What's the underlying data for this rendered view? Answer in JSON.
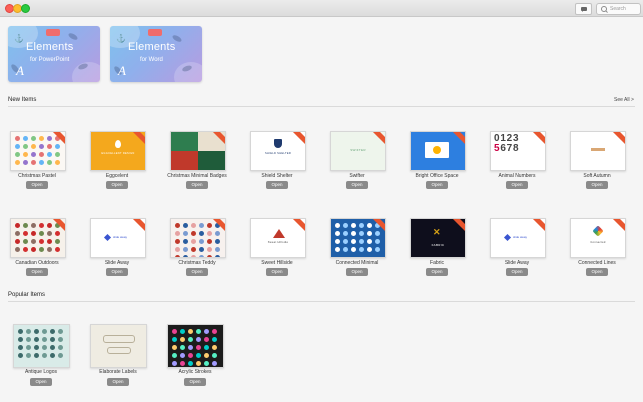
{
  "window": {
    "search_placeholder": "Search"
  },
  "banners": [
    {
      "title": "Elements",
      "subtitle": "for PowerPoint",
      "letter": "A"
    },
    {
      "title": "Elements",
      "subtitle": "for Word",
      "letter": "A"
    }
  ],
  "new_items": {
    "heading": "New Items",
    "see_all": "See All >",
    "open_label": "Open",
    "row1": [
      {
        "name": "Christmas Pastel",
        "thumb": "pastel"
      },
      {
        "name": "Eggcelent",
        "thumb": "egg",
        "thumb_text": "EGGCELLENT DESIGN"
      },
      {
        "name": "Christmas Minimal Badges",
        "thumb": "badges"
      },
      {
        "name": "Shield Shelter",
        "thumb": "shield",
        "thumb_text": "SHIELD SHELTER"
      },
      {
        "name": "Swifter",
        "thumb": "swifter",
        "thumb_text": "SWIFTER"
      },
      {
        "name": "Bright Office Space",
        "thumb": "office"
      },
      {
        "name": "Animal Numbers",
        "thumb": "numbers"
      },
      {
        "name": "Soft Autumn",
        "thumb": "autumn"
      }
    ],
    "row2": [
      {
        "name": "Canadian Outdoors",
        "thumb": "canadian"
      },
      {
        "name": "Slide Away",
        "thumb": "slide",
        "thumb_text": "slide away"
      },
      {
        "name": "Christmas Teddy",
        "thumb": "teddy"
      },
      {
        "name": "Sweet Hillside",
        "thumb": "hillside",
        "thumb_text": "Sweet Hillside"
      },
      {
        "name": "Connected Minimal",
        "thumb": "connected"
      },
      {
        "name": "Fabric",
        "thumb": "fabric",
        "thumb_text": "FABRIC"
      },
      {
        "name": "Slide Away",
        "thumb": "slide",
        "thumb_text": "slide away"
      },
      {
        "name": "Connected Lines",
        "thumb": "lines",
        "thumb_text": "Connected"
      }
    ]
  },
  "popular_items": {
    "heading": "Popular Items",
    "open_label": "Open",
    "items": [
      {
        "name": "Antique Logos",
        "thumb": "antique"
      },
      {
        "name": "Elaborate Labels",
        "thumb": "labels"
      },
      {
        "name": "Acrylic Strokes",
        "thumb": "acrylic"
      }
    ]
  }
}
